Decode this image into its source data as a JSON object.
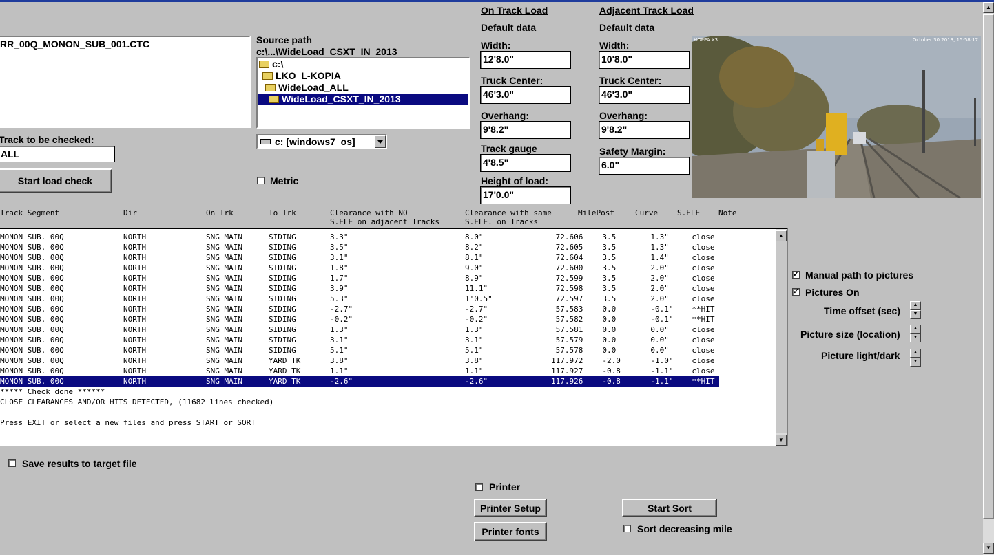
{
  "file_list": {
    "item": "RR_00Q_MONON_SUB_001.CTC"
  },
  "source": {
    "label": "Source path",
    "path": "c:\\...\\WideLoad_CSXT_IN_2013",
    "tree": [
      "c:\\",
      "LKO_L-KOPIA",
      "WideLoad_ALL",
      "WideLoad_CSXT_IN_2013"
    ],
    "drive": "c: [windows7_os]"
  },
  "track_check": {
    "label": "Track to be checked:",
    "value": "ALL"
  },
  "start_load_check": "Start load check",
  "metric": {
    "label": "Metric",
    "checked": false
  },
  "on_track": {
    "title": "On Track Load",
    "default": "Default data",
    "width_label": "Width:",
    "width": "12'8.0\"",
    "truck_label": "Truck Center:",
    "truck": "46'3.0\"",
    "overhang_label": "Overhang:",
    "overhang": "9'8.2\"",
    "gauge_label": "Track gauge",
    "gauge": "4'8.5\"",
    "height_label": "Height of load:",
    "height": "17'0.0\""
  },
  "adjacent_track": {
    "title": "Adjacent Track Load",
    "default": "Default data",
    "width_label": "Width:",
    "width": "10'8.0\"",
    "truck_label": "Truck Center:",
    "truck": "46'3.0\"",
    "overhang_label": "Overhang:",
    "overhang": "9'8.2\"",
    "margin_label": "Safety Margin:",
    "margin": "6.0\""
  },
  "photo": {
    "overlay_left": "HOPPA X3",
    "overlay_right": "October 30 2013, 15:58:17"
  },
  "table": {
    "headers": [
      [
        "Track Segment",
        ""
      ],
      [
        "Dir",
        ""
      ],
      [
        "On Trk",
        ""
      ],
      [
        "To Trk",
        ""
      ],
      [
        "Clearance with NO",
        "S.ELE on adjacent Tracks"
      ],
      [
        "Clearance with same",
        "S.ELE. on Tracks"
      ],
      [
        "MilePost",
        ""
      ],
      [
        "Curve",
        ""
      ],
      [
        "S.ELE",
        ""
      ],
      [
        "Note",
        ""
      ]
    ],
    "rows": [
      [
        "MONON SUB. 00Q",
        "NORTH",
        "SNG MAIN",
        "SIDING",
        "3.3\"",
        "8.0\"",
        "72.606",
        "3.5",
        "1.3\"",
        "close"
      ],
      [
        "MONON SUB. 00Q",
        "NORTH",
        "SNG MAIN",
        "SIDING",
        "3.5\"",
        "8.2\"",
        "72.605",
        "3.5",
        "1.3\"",
        "close"
      ],
      [
        "MONON SUB. 00Q",
        "NORTH",
        "SNG MAIN",
        "SIDING",
        "3.1\"",
        "8.1\"",
        "72.604",
        "3.5",
        "1.4\"",
        "close"
      ],
      [
        "MONON SUB. 00Q",
        "NORTH",
        "SNG MAIN",
        "SIDING",
        "1.8\"",
        "9.0\"",
        "72.600",
        "3.5",
        "2.0\"",
        "close"
      ],
      [
        "MONON SUB. 00Q",
        "NORTH",
        "SNG MAIN",
        "SIDING",
        "1.7\"",
        "8.9\"",
        "72.599",
        "3.5",
        "2.0\"",
        "close"
      ],
      [
        "MONON SUB. 00Q",
        "NORTH",
        "SNG MAIN",
        "SIDING",
        "3.9\"",
        "11.1\"",
        "72.598",
        "3.5",
        "2.0\"",
        "close"
      ],
      [
        "MONON SUB. 00Q",
        "NORTH",
        "SNG MAIN",
        "SIDING",
        "5.3\"",
        "1'0.5\"",
        "72.597",
        "3.5",
        "2.0\"",
        "close"
      ],
      [
        "MONON SUB. 00Q",
        "NORTH",
        "SNG MAIN",
        "SIDING",
        "-2.7\"",
        "-2.7\"",
        "57.583",
        "0.0",
        "-0.1\"",
        "**HIT"
      ],
      [
        "MONON SUB. 00Q",
        "NORTH",
        "SNG MAIN",
        "SIDING",
        "-0.2\"",
        "-0.2\"",
        "57.582",
        "0.0",
        "-0.1\"",
        "**HIT"
      ],
      [
        "MONON SUB. 00Q",
        "NORTH",
        "SNG MAIN",
        "SIDING",
        "1.3\"",
        "1.3\"",
        "57.581",
        "0.0",
        "0.0\"",
        "close"
      ],
      [
        "MONON SUB. 00Q",
        "NORTH",
        "SNG MAIN",
        "SIDING",
        "3.1\"",
        "3.1\"",
        "57.579",
        "0.0",
        "0.0\"",
        "close"
      ],
      [
        "MONON SUB. 00Q",
        "NORTH",
        "SNG MAIN",
        "SIDING",
        "5.1\"",
        "5.1\"",
        "57.578",
        "0.0",
        "0.0\"",
        "close"
      ],
      [
        "MONON SUB. 00Q",
        "NORTH",
        "SNG MAIN",
        "YARD TK",
        "3.8\"",
        "3.8\"",
        "117.972",
        "-2.0",
        "-1.0\"",
        "close"
      ],
      [
        "MONON SUB. 00Q",
        "NORTH",
        "SNG MAIN",
        "YARD TK",
        "1.1\"",
        "1.1\"",
        "117.927",
        "-0.8",
        "-1.1\"",
        "close"
      ],
      [
        "MONON SUB. 00Q",
        "NORTH",
        "SNG MAIN",
        "YARD TK",
        "-2.6\"",
        "-2.6\"",
        "117.926",
        "-0.8",
        "-1.1\"",
        "**HIT"
      ]
    ],
    "selected_row": 14,
    "messages": [
      "***** Check done ******",
      "CLOSE CLEARANCES AND/OR HITS DETECTED, (11682 lines checked)",
      "",
      "Press EXIT or select a new files and press START or SORT"
    ]
  },
  "options": {
    "manual_path": {
      "label": "Manual path to pictures",
      "checked": true
    },
    "pictures_on": {
      "label": "Pictures On",
      "checked": true
    },
    "time_offset": "Time offset (sec)",
    "picture_size": "Picture size (location)",
    "picture_light": "Picture light/dark"
  },
  "save_results": {
    "label": "Save results to target file",
    "checked": false
  },
  "printer": {
    "label": "Printer",
    "checked": false
  },
  "printer_setup": "Printer Setup",
  "printer_fonts": "Printer fonts",
  "start_sort": "Start Sort",
  "sort_decreasing": {
    "label": "Sort decreasing mile",
    "checked": false
  }
}
